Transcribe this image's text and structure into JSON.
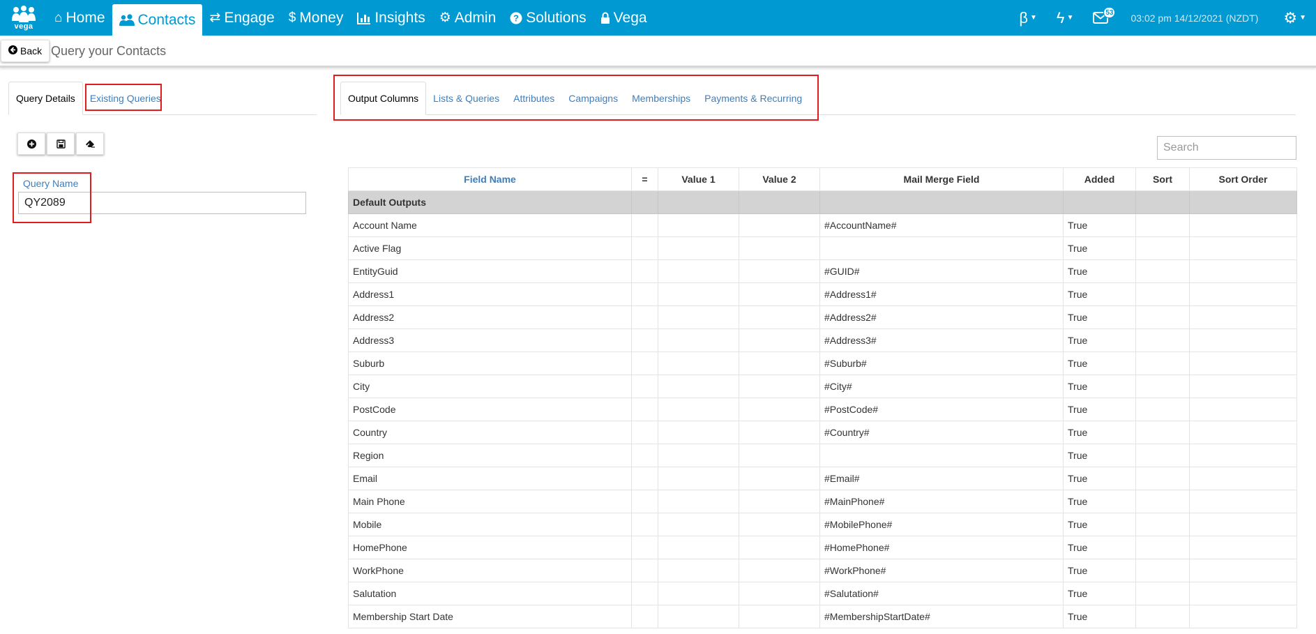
{
  "nav": {
    "logo_text": "vega",
    "items": [
      {
        "label": "Home",
        "icon": "home-icon",
        "glyph": "⌂"
      },
      {
        "label": "Contacts",
        "icon": "users-icon",
        "glyph": "👥"
      },
      {
        "label": "Engage",
        "icon": "exchange-icon",
        "glyph": "⇄"
      },
      {
        "label": "Money",
        "icon": "dollar-icon",
        "glyph": "$"
      },
      {
        "label": "Insights",
        "icon": "bar-chart-icon",
        "glyph": "📊"
      },
      {
        "label": "Admin",
        "icon": "cogs-icon",
        "glyph": "⚙"
      },
      {
        "label": "Solutions",
        "icon": "question-circle-icon",
        "glyph": "?"
      },
      {
        "label": "Vega",
        "icon": "lock-icon",
        "glyph": "🔒"
      }
    ],
    "beta_glyph": "β",
    "bolt_glyph": "ϟ",
    "mail_count": "53",
    "datetime": "03:02 pm 14/12/2021 (NZDT)",
    "settings_glyph": "⚙"
  },
  "subheader": {
    "back_label": "Back",
    "title": "Query your Contacts"
  },
  "left_tabs": {
    "query_details": "Query Details",
    "existing_queries": "Existing Queries"
  },
  "right_tabs": {
    "output_columns": "Output Columns",
    "lists_queries": "Lists & Queries",
    "attributes": "Attributes",
    "campaigns": "Campaigns",
    "memberships": "Memberships",
    "payments_recurring": "Payments & Recurring"
  },
  "query": {
    "label": "Query Name",
    "value": "QY2089"
  },
  "search": {
    "placeholder": "Search"
  },
  "grid": {
    "headers": {
      "field_name": "Field Name",
      "eq": "=",
      "value1": "Value 1",
      "value2": "Value 2",
      "mail_merge": "Mail Merge Field",
      "added": "Added",
      "sort": "Sort",
      "sort_order": "Sort Order"
    },
    "group_label": "Default Outputs",
    "rows": [
      {
        "field": "Account Name",
        "merge": "#AccountName#",
        "added": "True"
      },
      {
        "field": "Active Flag",
        "merge": "",
        "added": "True"
      },
      {
        "field": "EntityGuid",
        "merge": "#GUID#",
        "added": "True"
      },
      {
        "field": "Address1",
        "merge": "#Address1#",
        "added": "True"
      },
      {
        "field": "Address2",
        "merge": "#Address2#",
        "added": "True"
      },
      {
        "field": "Address3",
        "merge": "#Address3#",
        "added": "True"
      },
      {
        "field": "Suburb",
        "merge": "#Suburb#",
        "added": "True"
      },
      {
        "field": "City",
        "merge": "#City#",
        "added": "True"
      },
      {
        "field": "PostCode",
        "merge": "#PostCode#",
        "added": "True"
      },
      {
        "field": "Country",
        "merge": "#Country#",
        "added": "True"
      },
      {
        "field": "Region",
        "merge": "",
        "added": "True"
      },
      {
        "field": "Email",
        "merge": "#Email#",
        "added": "True"
      },
      {
        "field": "Main Phone",
        "merge": "#MainPhone#",
        "added": "True"
      },
      {
        "field": "Mobile",
        "merge": "#MobilePhone#",
        "added": "True"
      },
      {
        "field": "HomePhone",
        "merge": "#HomePhone#",
        "added": "True"
      },
      {
        "field": "WorkPhone",
        "merge": "#WorkPhone#",
        "added": "True"
      },
      {
        "field": "Salutation",
        "merge": "#Salutation#",
        "added": "True"
      },
      {
        "field": "Membership Start Date",
        "merge": "#MembershipStartDate#",
        "added": "True"
      }
    ]
  },
  "colors": {
    "nav_bg": "#0099d1",
    "link": "#3c7fbf",
    "highlight": "#e21a1a",
    "group_row": "#d3d3d3"
  }
}
